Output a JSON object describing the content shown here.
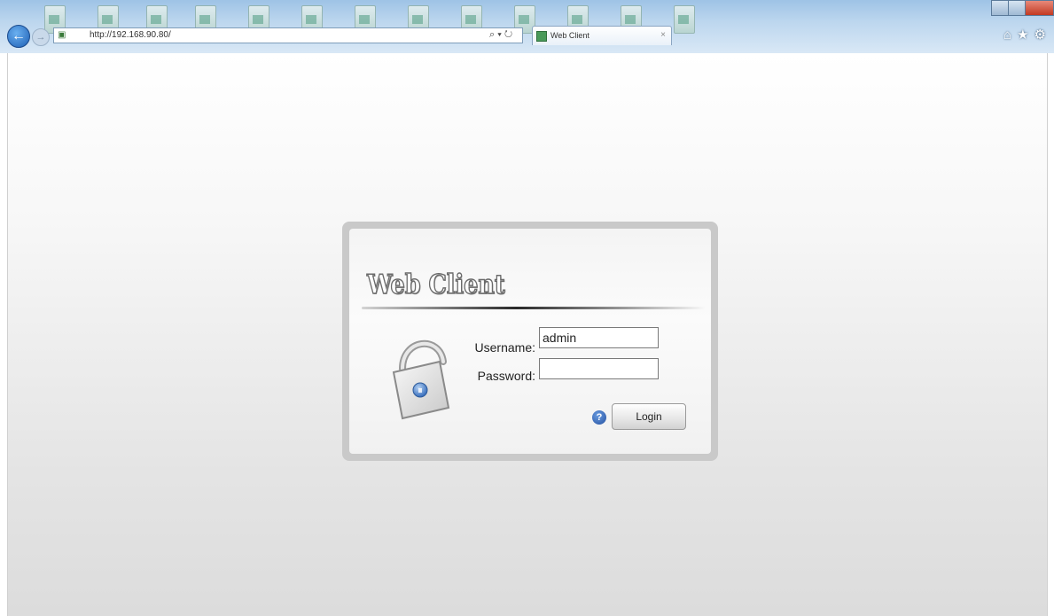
{
  "browser": {
    "address_url": "http://192.168.90.80/",
    "tab_title": "Web Client",
    "search_glyph": "⌕ ▾ ↻",
    "icons": [
      "back-arrow-icon",
      "forward-arrow-icon",
      "compatibility-icon",
      "page-icon",
      "search-icon",
      "refresh-icon",
      "tab-close-icon",
      "home-icon",
      "favorites-star-icon",
      "settings-gear-icon"
    ]
  },
  "login": {
    "logo_text": "Web Client",
    "username_label": "Username:",
    "password_label": "Password:",
    "username_value": "admin",
    "password_value": "",
    "help_glyph": "?",
    "login_button": "Login"
  },
  "colors": {
    "chrome_blue": "#9ec3e6",
    "panel_frame": "#c9c9c9",
    "help_icon_blue": "#2450a0"
  }
}
